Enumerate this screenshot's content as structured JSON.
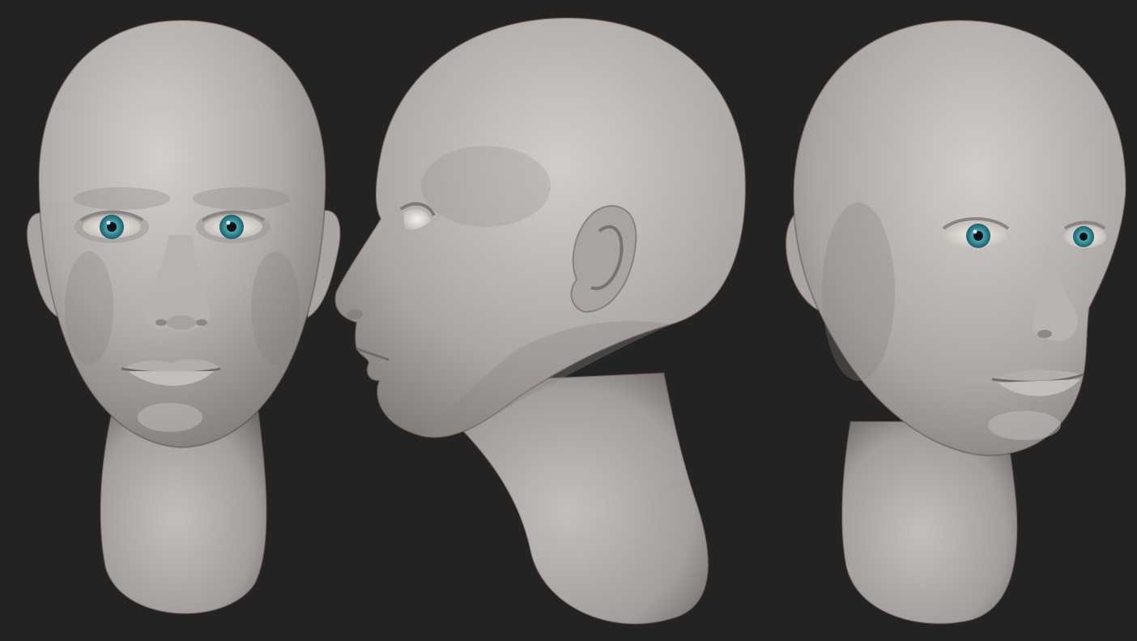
{
  "scene": {
    "background_color": "#232323",
    "skin_highlight": "#cfccc9",
    "skin_mid": "#aaa6a3",
    "skin_shadow": "#7f7b79",
    "rim_color": "#5a3a33",
    "iris_color": "#3e98a3",
    "iris_dark": "#1d5e68",
    "pupil_color": "#0b1114",
    "sclera_color": "#e9e6e2",
    "views": [
      {
        "view": "front"
      },
      {
        "view": "profile-left"
      },
      {
        "view": "three-quarter-right"
      }
    ]
  }
}
